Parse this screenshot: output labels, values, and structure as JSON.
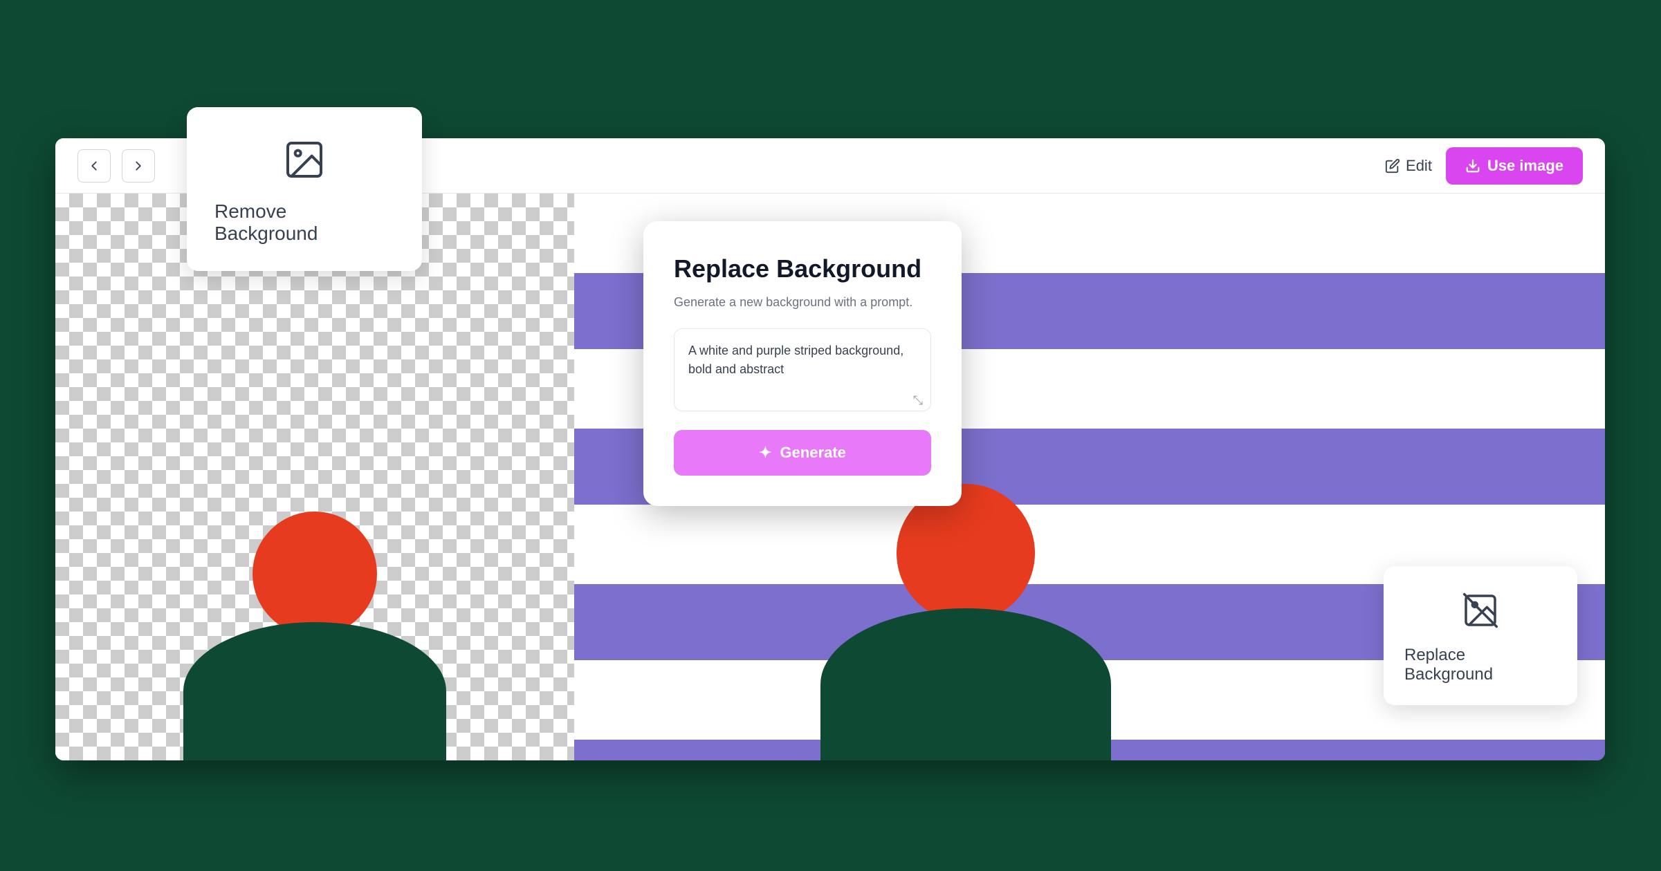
{
  "page": {
    "background_color": "#0e4a33"
  },
  "browser": {
    "toolbar": {
      "back_icon": "←",
      "forward_icon": "→",
      "edit_label": "Edit",
      "edit_icon": "✏",
      "use_image_label": "Use image",
      "use_image_icon": "⬇"
    }
  },
  "remove_bg_card": {
    "icon": "🖼",
    "label": "Remove Background"
  },
  "replace_bg_panel": {
    "title": "Replace Background",
    "description": "Generate a new background with a prompt.",
    "prompt_value": "A white and purple striped background, bold and abstract",
    "generate_label": "Generate",
    "generate_icon": "✦"
  },
  "replace_bg_card": {
    "label": "Replace Background"
  }
}
